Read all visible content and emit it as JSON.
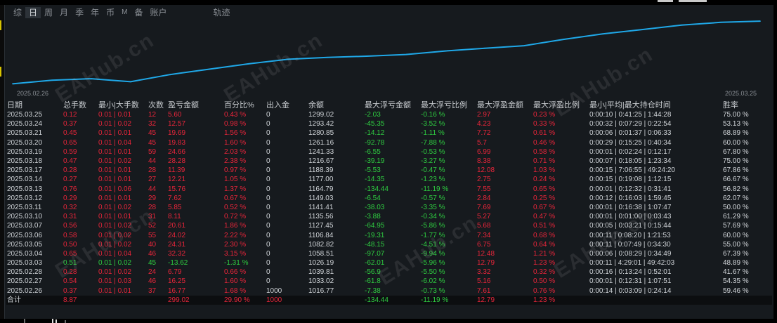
{
  "tabs": [
    {
      "label": "综",
      "active": false
    },
    {
      "label": "日",
      "active": true
    },
    {
      "label": "周",
      "active": false
    },
    {
      "label": "月",
      "active": false
    },
    {
      "label": "季",
      "active": false
    },
    {
      "label": "年",
      "active": false
    },
    {
      "label": "币",
      "active": false
    },
    {
      "label": "M",
      "active": false
    },
    {
      "label": "备",
      "active": false
    },
    {
      "label": "账户",
      "active": false
    },
    {
      "label": "轨迹",
      "active": false
    }
  ],
  "chart_data": {
    "type": "line",
    "x": [
      "2025.02.26",
      "2025.02.27",
      "2025.02.28",
      "2025.03.03",
      "2025.03.04",
      "2025.03.05",
      "2025.03.06",
      "2025.03.07",
      "2025.03.10",
      "2025.03.11",
      "2025.03.12",
      "2025.03.13",
      "2025.03.14",
      "2025.03.17",
      "2025.03.18",
      "2025.03.19",
      "2025.03.20",
      "2025.03.21",
      "2025.03.24",
      "2025.03.25"
    ],
    "values": [
      1016.77,
      1033.02,
      1039.81,
      1026.19,
      1058.51,
      1082.82,
      1106.84,
      1127.45,
      1135.56,
      1141.41,
      1149.03,
      1164.79,
      1177.0,
      1188.39,
      1216.67,
      1241.33,
      1261.16,
      1280.85,
      1293.42,
      1299.02
    ],
    "start_label": "2025.02.26",
    "end_label": "2025.03.25",
    "color": "#1fa8e8"
  },
  "table": {
    "headers": [
      "日期",
      "总手数",
      "最小|大手数",
      "次数",
      "盈亏金额",
      "百分比%",
      "出入金",
      "余额",
      "最大浮亏金额",
      "最大浮亏比例",
      "最大浮盈金额",
      "最大浮盈比例",
      "最小|平均|最大持仓时间",
      "胜率"
    ],
    "rows": [
      [
        "2025.03.25",
        "0.12",
        "0.01 | 0.01",
        "12",
        "5.60",
        "0.43 %",
        "0",
        "1299.02",
        "-2.03",
        "-0.16 %",
        "2.97",
        "0.23 %",
        "0:00:10 | 0:41:25 | 1:44:28",
        "75.00 %"
      ],
      [
        "2025.03.24",
        "0.37",
        "0.01 | 0.02",
        "32",
        "12.57",
        "0.98 %",
        "0",
        "1293.42",
        "-45.35",
        "-3.52 %",
        "4.23",
        "0.33 %",
        "0:00:32 | 0:07:29 | 0:22:54",
        "53.13 %"
      ],
      [
        "2025.03.21",
        "0.45",
        "0.01 | 0.01",
        "45",
        "19.69",
        "1.56 %",
        "0",
        "1280.85",
        "-14.12",
        "-1.11 %",
        "7.72",
        "0.61 %",
        "0:00:06 | 0:01:37 | 0:06:33",
        "68.89 %"
      ],
      [
        "2025.03.20",
        "0.65",
        "0.01 | 0.04",
        "45",
        "19.83",
        "1.60 %",
        "0",
        "1261.16",
        "-92.78",
        "-7.88 %",
        "5.7",
        "0.46 %",
        "0:00:29 | 0:15:25 | 0:40:34",
        "60.00 %"
      ],
      [
        "2025.03.19",
        "0.59",
        "0.01 | 0.01",
        "59",
        "24.66",
        "2.03 %",
        "0",
        "1241.33",
        "-6.55",
        "-0.53 %",
        "6.99",
        "0.58 %",
        "0:00:01 | 0:02:24 | 0:12:17",
        "67.80 %"
      ],
      [
        "2025.03.18",
        "0.47",
        "0.01 | 0.02",
        "44",
        "28.28",
        "2.38 %",
        "0",
        "1216.67",
        "-39.19",
        "-3.27 %",
        "8.38",
        "0.71 %",
        "0:00:07 | 0:18:05 | 1:23:34",
        "75.00 %"
      ],
      [
        "2025.03.17",
        "0.28",
        "0.01 | 0.01",
        "28",
        "11.39",
        "0.97 %",
        "0",
        "1188.39",
        "-5.53",
        "-0.47 %",
        "12.08",
        "1.03 %",
        "0:00:15 | 7:06:55 | 49:24:20",
        "67.86 %"
      ],
      [
        "2025.03.14",
        "0.27",
        "0.01 | 0.01",
        "27",
        "12.21",
        "1.05 %",
        "0",
        "1177.00",
        "-14.35",
        "-1.23 %",
        "2.75",
        "0.24 %",
        "0:00:15 | 0:19:08 | 1:12:15",
        "66.67 %"
      ],
      [
        "2025.03.13",
        "0.76",
        "0.01 | 0.06",
        "44",
        "15.76",
        "1.37 %",
        "0",
        "1164.79",
        "-134.44",
        "-11.19 %",
        "7.55",
        "0.65 %",
        "0:00:01 | 0:12:32 | 0:31:41",
        "56.82 %"
      ],
      [
        "2025.03.12",
        "0.29",
        "0.01 | 0.01",
        "29",
        "7.62",
        "0.67 %",
        "0",
        "1149.03",
        "-6.54",
        "-0.57 %",
        "2.84",
        "0.25 %",
        "0:00:12 | 0:16:03 | 1:59:45",
        "62.07 %"
      ],
      [
        "2025.03.11",
        "0.32",
        "0.01 | 0.02",
        "28",
        "5.85",
        "0.52 %",
        "0",
        "1141.41",
        "-38.03",
        "-3.35 %",
        "7.69",
        "0.67 %",
        "0:00:01 | 0:16:38 | 1:07:47",
        "50.00 %"
      ],
      [
        "2025.03.10",
        "0.31",
        "0.01 | 0.01",
        "31",
        "8.11",
        "0.72 %",
        "0",
        "1135.56",
        "-3.88",
        "-0.34 %",
        "5.27",
        "0.47 %",
        "0:00:01 | 0:01:00 | 0:03:43",
        "61.29 %"
      ],
      [
        "2025.03.07",
        "0.56",
        "0.01 | 0.02",
        "52",
        "20.61",
        "1.86 %",
        "0",
        "1127.45",
        "-64.95",
        "-5.86 %",
        "5.68",
        "0.51 %",
        "0:00:05 | 0:03:21 | 0:15:44",
        "57.69 %"
      ],
      [
        "2025.03.06",
        "0.58",
        "0.01 | 0.02",
        "55",
        "24.02",
        "2.22 %",
        "0",
        "1106.84",
        "-19.31",
        "-1.77 %",
        "7.34",
        "0.68 %",
        "0:00:11 | 0:08:20 | 1:21:53",
        "60.00 %"
      ],
      [
        "2025.03.05",
        "0.50",
        "0.01 | 0.02",
        "40",
        "24.31",
        "2.30 %",
        "0",
        "1082.82",
        "-48.15",
        "-4.51 %",
        "6.75",
        "0.64 %",
        "0:00:11 | 0:07:49 | 0:34:30",
        "55.00 %"
      ],
      [
        "2025.03.04",
        "0.65",
        "0.01 | 0.04",
        "46",
        "32.32",
        "3.15 %",
        "0",
        "1058.51",
        "-97.07",
        "-9.94 %",
        "12.48",
        "1.21 %",
        "0:00:06 | 0:08:29 | 0:34:49",
        "67.39 %"
      ],
      [
        "2025.03.03",
        "0.51",
        "0.01 | 0.02",
        "45",
        "-13.62",
        "-1.31 %",
        "0",
        "1026.19",
        "-62.01",
        "-5.96 %",
        "12.79",
        "1.23 %",
        "0:00:11 | 4:29:01 | 49:42:03",
        "48.89 %"
      ],
      [
        "2025.02.28",
        "0.28",
        "0.01 | 0.02",
        "24",
        "6.79",
        "0.66 %",
        "0",
        "1039.81",
        "-56.9",
        "-5.50 %",
        "3.32",
        "0.32 %",
        "0:00:16 | 0:13:24 | 0:52:01",
        "41.67 %"
      ],
      [
        "2025.02.27",
        "0.54",
        "0.01 | 0.03",
        "46",
        "16.25",
        "1.60 %",
        "0",
        "1033.02",
        "-61.8",
        "-6.02 %",
        "5.16",
        "0.50 %",
        "0:00:01 | 0:12:31 | 1:07:51",
        "54.35 %"
      ],
      [
        "2025.02.26",
        "0.37",
        "0.01 | 0.01",
        "37",
        "16.77",
        "1.68 %",
        "1000",
        "1016.77",
        "-7.38",
        "-0.73 %",
        "7.61",
        "0.76 %",
        "0:00:14 | 0:03:09 | 0:24:14",
        "59.46 %"
      ]
    ],
    "total": [
      "合计",
      "8.87",
      "",
      "",
      "299.02",
      "29.90 %",
      "1000",
      "",
      "-134.44",
      "-11.19 %",
      "12.79",
      "1.23 %",
      "",
      ""
    ]
  },
  "watermark": "EAHub.cn"
}
